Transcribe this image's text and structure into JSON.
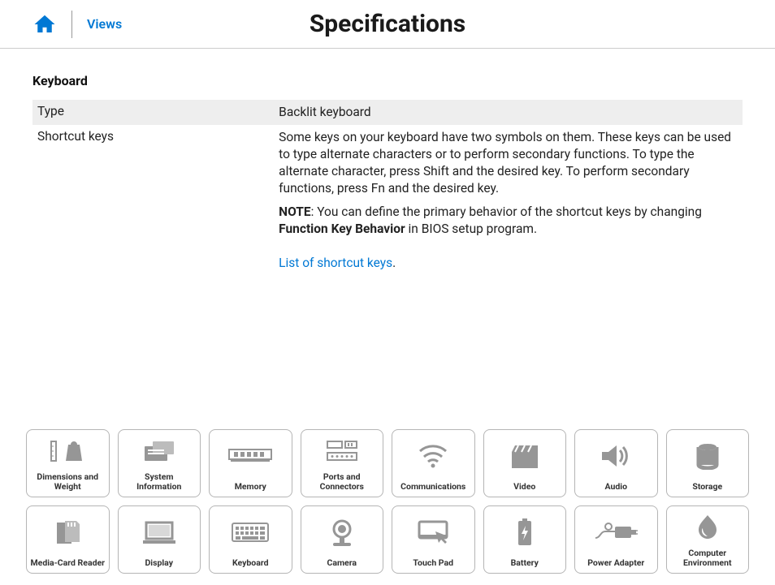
{
  "header": {
    "views_label": "Views",
    "title": "Specifications"
  },
  "section": {
    "heading": "Keyboard",
    "rows": [
      {
        "label": "Type",
        "value": "Backlit keyboard"
      },
      {
        "label": "Shortcut keys",
        "value": "Some keys on your keyboard have two symbols on them. These keys can be used to type alternate characters or to perform secondary functions. To type the alternate character, press Shift and the desired key. To perform secondary functions, press Fn and the desired key.",
        "note_label": "NOTE",
        "note_text": ": You can define the primary behavior of the shortcut keys by changing ",
        "note_bold": "Function Key Behavior",
        "note_tail": " in BIOS setup program.",
        "link_text": "List of shortcut keys",
        "link_period": "."
      }
    ]
  },
  "nav": [
    {
      "label": "Dimensions and Weight",
      "icon": "dimensions-weight-icon"
    },
    {
      "label": "System Information",
      "icon": "system-info-icon"
    },
    {
      "label": "Memory",
      "icon": "memory-icon"
    },
    {
      "label": "Ports and Connectors",
      "icon": "ports-icon"
    },
    {
      "label": "Communications",
      "icon": "communications-icon"
    },
    {
      "label": "Video",
      "icon": "video-icon"
    },
    {
      "label": "Audio",
      "icon": "audio-icon"
    },
    {
      "label": "Storage",
      "icon": "storage-icon"
    },
    {
      "label": "Media-Card Reader",
      "icon": "media-card-icon"
    },
    {
      "label": "Display",
      "icon": "display-icon"
    },
    {
      "label": "Keyboard",
      "icon": "keyboard-icon"
    },
    {
      "label": "Camera",
      "icon": "camera-icon"
    },
    {
      "label": "Touch Pad",
      "icon": "touchpad-icon"
    },
    {
      "label": "Battery",
      "icon": "battery-icon"
    },
    {
      "label": "Power Adapter",
      "icon": "power-adapter-icon"
    },
    {
      "label": "Computer Environment",
      "icon": "environment-icon"
    }
  ]
}
